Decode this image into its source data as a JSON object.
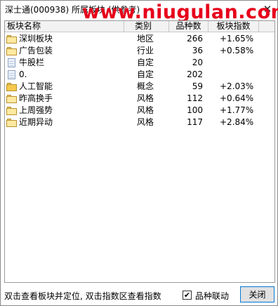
{
  "window": {
    "title": "深士通(000938)  所属板块 (供参考)",
    "close_glyph": "✕"
  },
  "watermark": {
    "text": "www.niugulan.com",
    "color": "#e6001a"
  },
  "table": {
    "columns": [
      "板块名称",
      "类别",
      "品种数",
      "板块指数"
    ],
    "rows": [
      {
        "icon": "folder-icon",
        "name": "深圳板块",
        "type": "地区",
        "count": "266",
        "index": "+1.65%"
      },
      {
        "icon": "folder-icon",
        "name": "广告包装",
        "type": "行业",
        "count": "36",
        "index": "+0.58%"
      },
      {
        "icon": "document-icon",
        "name": "牛股栏",
        "type": "自定",
        "count": "20",
        "index": ""
      },
      {
        "icon": "document-icon",
        "name": "0.",
        "type": "自定",
        "count": "202",
        "index": ""
      },
      {
        "icon": "folder-open-icon",
        "name": "人工智能",
        "type": "概念",
        "count": "59",
        "index": "+2.03%"
      },
      {
        "icon": "folder-icon",
        "name": "昨高换手",
        "type": "风格",
        "count": "112",
        "index": "+0.64%"
      },
      {
        "icon": "folder-icon",
        "name": "上周强势",
        "type": "风格",
        "count": "100",
        "index": "+1.77%"
      },
      {
        "icon": "folder-icon",
        "name": "近期异动",
        "type": "风格",
        "count": "117",
        "index": "+2.84%"
      }
    ]
  },
  "status": {
    "hint": "双击查看板块并定位, 双击指数区查看指数",
    "checkbox_label": "品种联动",
    "checkbox_checked": true,
    "close_button": "关闭"
  }
}
